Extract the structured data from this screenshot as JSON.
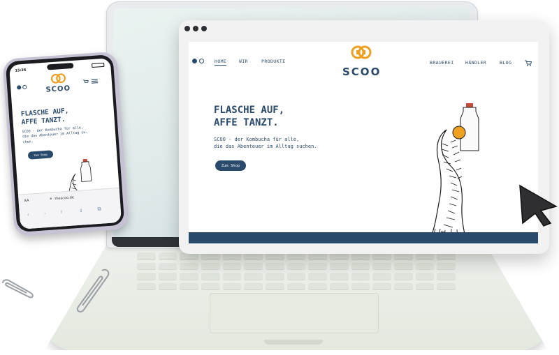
{
  "site": {
    "brand": "SCOO",
    "nav_left": [
      "HOME",
      "WIR",
      "PRODUKTE"
    ],
    "nav_right": [
      "BRAUEREI",
      "HÄNDLER",
      "BLOG"
    ],
    "headline_line1": "FLASCHE AUF,",
    "headline_line2": "AFFE TANZT.",
    "subcopy_line1": "SCOO - der Kombucha für alle,",
    "subcopy_line2": "die das Abenteuer im Alltag suchen.",
    "cta": "Zum Shop",
    "colors": {
      "brand_blue": "#2a4a6b",
      "logo_orange": "#f0a020"
    }
  },
  "phone": {
    "time": "15:26",
    "brand": "SCOO",
    "headline_line1": "FLASCHE AUF,",
    "headline_line2": "AFFE TANZT.",
    "subcopy_line1": "SCOO - der Kombucha für alle,",
    "subcopy_line2": "die das Abenteuer im Alltag su-",
    "subcopy_line3": "chen.",
    "cta": "Zum Shop",
    "url": "thescoo.de",
    "text_size_label": "AA"
  },
  "icons": [
    "facebook-icon",
    "instagram-icon",
    "cart-icon",
    "menu-icon",
    "lock-icon",
    "share-icon",
    "bookmarks-icon",
    "tabs-icon",
    "back-icon",
    "forward-icon",
    "reload-icon",
    "cursor-icon",
    "paperclip-icon"
  ]
}
